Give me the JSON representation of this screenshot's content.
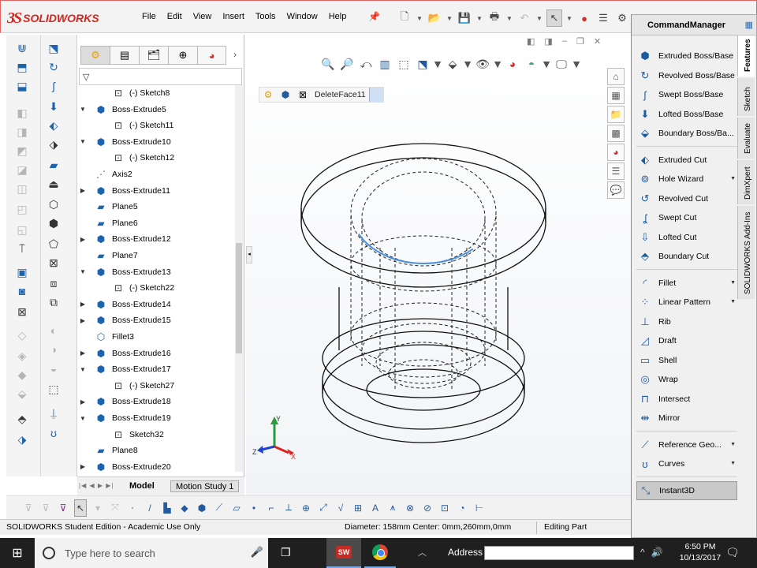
{
  "app": {
    "brand_ds": "3S",
    "brand_name": "SOLIDWORKS"
  },
  "menu": [
    "File",
    "Edit",
    "View",
    "Insert",
    "Tools",
    "Window",
    "Help"
  ],
  "command_manager": {
    "title": "CommandManager",
    "items": [
      {
        "label": "Extruded Boss/Base",
        "icon": "extruded-boss-icon"
      },
      {
        "label": "Revolved Boss/Base",
        "icon": "revolved-boss-icon"
      },
      {
        "label": "Swept Boss/Base",
        "icon": "swept-boss-icon"
      },
      {
        "label": "Lofted Boss/Base",
        "icon": "lofted-boss-icon"
      },
      {
        "label": "Boundary Boss/Ba...",
        "icon": "boundary-boss-icon"
      },
      {
        "label": "Extruded Cut",
        "icon": "extruded-cut-icon"
      },
      {
        "label": "Hole Wizard",
        "icon": "hole-wizard-icon",
        "dropdown": true
      },
      {
        "label": "Revolved Cut",
        "icon": "revolved-cut-icon"
      },
      {
        "label": "Swept Cut",
        "icon": "swept-cut-icon"
      },
      {
        "label": "Lofted Cut",
        "icon": "lofted-cut-icon"
      },
      {
        "label": "Boundary Cut",
        "icon": "boundary-cut-icon"
      },
      {
        "label": "Fillet",
        "icon": "fillet-icon",
        "dropdown": true
      },
      {
        "label": "Linear Pattern",
        "icon": "linear-pattern-icon",
        "dropdown": true
      },
      {
        "label": "Rib",
        "icon": "rib-icon"
      },
      {
        "label": "Draft",
        "icon": "draft-icon"
      },
      {
        "label": "Shell",
        "icon": "shell-icon"
      },
      {
        "label": "Wrap",
        "icon": "wrap-icon"
      },
      {
        "label": "Intersect",
        "icon": "intersect-icon"
      },
      {
        "label": "Mirror",
        "icon": "mirror-icon"
      },
      {
        "label": "Reference Geo...",
        "icon": "reference-geometry-icon",
        "dropdown": true
      },
      {
        "label": "Curves",
        "icon": "curves-icon",
        "dropdown": true
      },
      {
        "label": "Instant3D",
        "icon": "instant3d-icon",
        "active": true
      }
    ],
    "tabs": [
      "Features",
      "Sketch",
      "Evaluate",
      "DimXpert",
      "SOLIDWORKS Add-Ins"
    ]
  },
  "feature_tree": [
    {
      "label": "(-) Sketch8",
      "level": 2,
      "type": "sketch"
    },
    {
      "label": "Boss-Extrude5",
      "level": 1,
      "type": "extrude",
      "expanded": true
    },
    {
      "label": "(-) Sketch11",
      "level": 2,
      "type": "sketch"
    },
    {
      "label": "Boss-Extrude10",
      "level": 1,
      "type": "extrude",
      "expanded": true
    },
    {
      "label": "(-) Sketch12",
      "level": 2,
      "type": "sketch"
    },
    {
      "label": "Axis2",
      "level": 1,
      "type": "axis"
    },
    {
      "label": "Boss-Extrude11",
      "level": 1,
      "type": "extrude",
      "expanded": false
    },
    {
      "label": "Plane5",
      "level": 1,
      "type": "plane"
    },
    {
      "label": "Plane6",
      "level": 1,
      "type": "plane"
    },
    {
      "label": "Boss-Extrude12",
      "level": 1,
      "type": "extrude",
      "expanded": false
    },
    {
      "label": "Plane7",
      "level": 1,
      "type": "plane"
    },
    {
      "label": "Boss-Extrude13",
      "level": 1,
      "type": "extrude",
      "expanded": true
    },
    {
      "label": "(-) Sketch22",
      "level": 2,
      "type": "sketch"
    },
    {
      "label": "Boss-Extrude14",
      "level": 1,
      "type": "extrude",
      "expanded": false
    },
    {
      "label": "Boss-Extrude15",
      "level": 1,
      "type": "extrude",
      "expanded": false
    },
    {
      "label": "Fillet3",
      "level": 1,
      "type": "fillet"
    },
    {
      "label": "Boss-Extrude16",
      "level": 1,
      "type": "extrude",
      "expanded": false
    },
    {
      "label": "Boss-Extrude17",
      "level": 1,
      "type": "extrude",
      "expanded": true
    },
    {
      "label": "(-) Sketch27",
      "level": 2,
      "type": "sketch"
    },
    {
      "label": "Boss-Extrude18",
      "level": 1,
      "type": "extrude",
      "expanded": false
    },
    {
      "label": "Boss-Extrude19",
      "level": 1,
      "type": "extrude",
      "expanded": true
    },
    {
      "label": "Sketch32",
      "level": 2,
      "type": "sketch"
    },
    {
      "label": "Plane8",
      "level": 1,
      "type": "plane"
    },
    {
      "label": "Boss-Extrude20",
      "level": 1,
      "type": "extrude",
      "expanded": false
    }
  ],
  "bottom_tabs": {
    "model": "Model",
    "motion": "Motion Study 1"
  },
  "breadcrumb": {
    "feature": "DeleteFace11"
  },
  "triad": {
    "x": "X",
    "y": "Y",
    "z": "Z"
  },
  "status": {
    "edition": "SOLIDWORKS Student Edition - Academic Use Only",
    "measure": "Diameter: 158mm  Center: 0mm,260mm,0mm",
    "mode": "Editing Part"
  },
  "taskbar": {
    "search_placeholder": "Type here to search",
    "address_label": "Address",
    "sw_badge": "SW",
    "time": "6:50 PM",
    "date": "10/13/2017"
  },
  "colors": {
    "brand_red": "#d1271f",
    "accent_blue": "#1d63ad",
    "selected_edge": "#4a90e2"
  }
}
